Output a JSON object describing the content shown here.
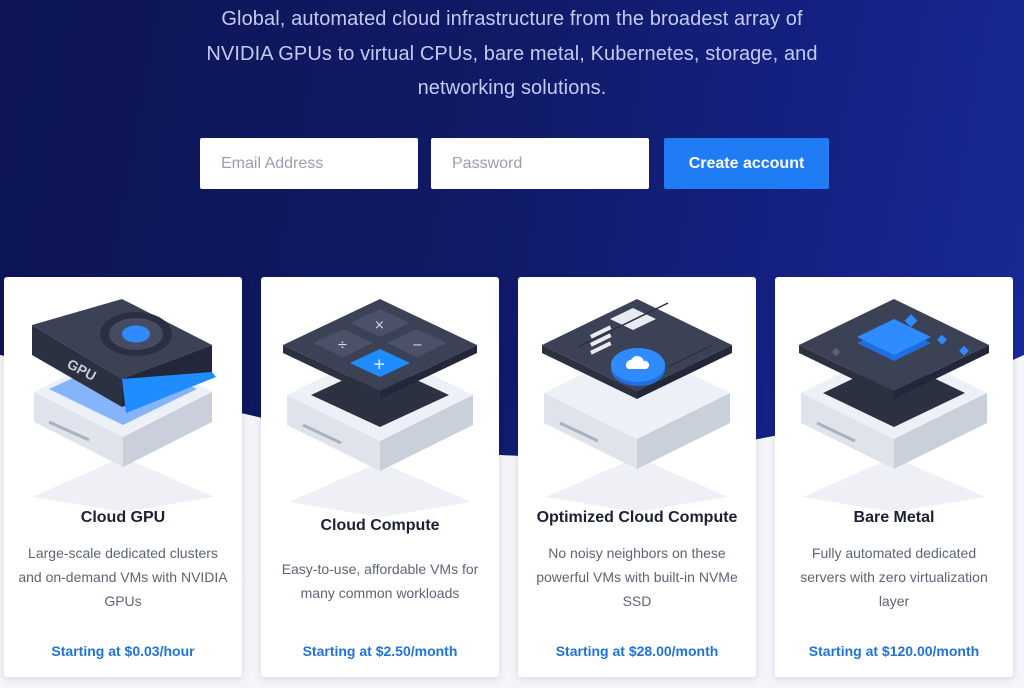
{
  "hero": {
    "tagline": "Global, automated cloud infrastructure from the broadest array of NVIDIA GPUs to virtual CPUs, bare metal, Kubernetes, storage, and networking solutions."
  },
  "signup": {
    "email_placeholder": "Email Address",
    "password_placeholder": "Password",
    "submit_label": "Create account"
  },
  "products": [
    {
      "title": "Cloud GPU",
      "description": "Large-scale dedicated clusters and on-demand VMs with NVIDIA GPUs",
      "price": "Starting at $0.03/hour",
      "chip_label": "GPU",
      "icon": "gpu-card-icon"
    },
    {
      "title": "Cloud Compute",
      "description": "Easy-to-use, affordable VMs for many common workloads",
      "price": "Starting at $2.50/month",
      "icon": "calculator-keys-icon"
    },
    {
      "title": "Optimized Cloud Compute",
      "description": "No noisy neighbors on these powerful VMs with built-in NVMe SSD",
      "price": "Starting at $28.00/month",
      "icon": "cloud-board-icon"
    },
    {
      "title": "Bare Metal",
      "description": "Fully automated dedicated servers with zero virtualization layer",
      "price": "Starting at $120.00/month",
      "icon": "motherboard-chip-icon"
    }
  ],
  "colors": {
    "hero_dark": "#0d1554",
    "hero_light": "#1b2a98",
    "accent": "#1f7cf4",
    "price_text": "#1f73d9"
  }
}
